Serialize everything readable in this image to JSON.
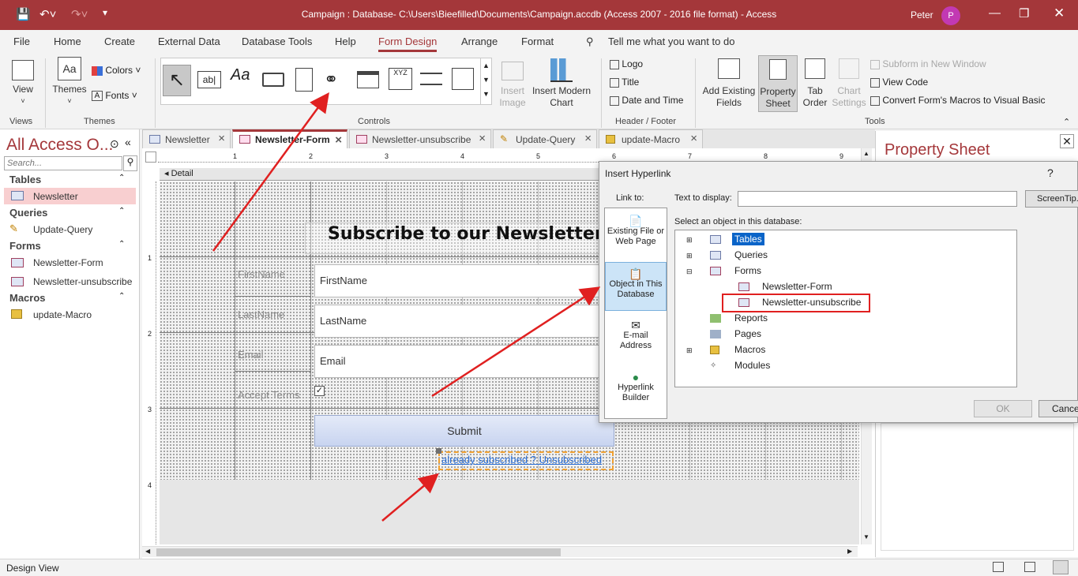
{
  "titlebar": {
    "title": "Campaign : Database- C:\\Users\\Bieefilled\\Documents\\Campaign.accdb (Access 2007 - 2016 file format)  -  Access",
    "user": "Peter",
    "avatar_letter": "P"
  },
  "menu": [
    "File",
    "Home",
    "Create",
    "External Data",
    "Database Tools",
    "Help",
    "Form Design",
    "Arrange",
    "Format"
  ],
  "tell_me": "Tell me what you want to do",
  "ribbon": {
    "view": "View",
    "themes": "Themes",
    "colors": "Colors",
    "fonts": "Fonts",
    "insert_image": "Insert Image",
    "insert_modern_chart": "Insert Modern Chart",
    "logo": "Logo",
    "title": "Title",
    "date_time": "Date and Time",
    "add_existing_fields": "Add Existing Fields",
    "property_sheet": "Property Sheet",
    "tab_order": "Tab Order",
    "chart_settings": "Chart Settings",
    "subform": "Subform in New Window",
    "view_code": "View Code",
    "convert_macros": "Convert Form's Macros to Visual Basic",
    "groups": {
      "views": "Views",
      "themes": "Themes",
      "controls": "Controls",
      "header_footer": "Header / Footer",
      "tools": "Tools"
    },
    "control_samples": {
      "textbox": "ab|",
      "label": "Aa",
      "xyz": "XYZ"
    }
  },
  "nav": {
    "header": "All Access O...",
    "search_placeholder": "Search...",
    "sections": [
      {
        "name": "Tables",
        "items": [
          "Newsletter"
        ]
      },
      {
        "name": "Queries",
        "items": [
          "Update-Query"
        ]
      },
      {
        "name": "Forms",
        "items": [
          "Newsletter-Form",
          "Newsletter-unsubscribe"
        ]
      },
      {
        "name": "Macros",
        "items": [
          "update-Macro"
        ]
      }
    ]
  },
  "tabs": [
    "Newsletter",
    "Newsletter-Form",
    "Newsletter-unsubscribe",
    "Update-Query",
    "update-Macro"
  ],
  "form": {
    "detail_label": "Detail",
    "heading": "Subscribe to our Newsletter!",
    "labels": [
      "FirstName",
      "LastName",
      "Email",
      "Accept Terms"
    ],
    "fields": [
      "FirstName",
      "LastName",
      "Email"
    ],
    "submit": "Submit",
    "link": "already subscribed ? Unsubscribed",
    "ruler_numbers": [
      "1",
      "2",
      "3",
      "4",
      "5",
      "6",
      "7",
      "8",
      "9"
    ],
    "vruler_numbers": [
      "1",
      "2",
      "3",
      "4"
    ]
  },
  "property_sheet": {
    "title": "Property Sheet"
  },
  "dialog": {
    "title": "Insert Hyperlink",
    "help": "?",
    "link_to": "Link to:",
    "text_to_display_label": "Text to display:",
    "text_to_display_value": "",
    "screentip": "ScreenTip...",
    "select_label": "Select an object in this database:",
    "link_options": [
      "Existing File or Web Page",
      "Object in This Database",
      "E-mail Address",
      "Hyperlink Builder"
    ],
    "tree": {
      "tables": "Tables",
      "queries": "Queries",
      "forms": "Forms",
      "form_items": [
        "Newsletter-Form",
        "Newsletter-unsubscribe"
      ],
      "reports": "Reports",
      "pages": "Pages",
      "macros": "Macros",
      "modules": "Modules"
    },
    "ok": "OK",
    "cancel": "Cancel"
  },
  "status": {
    "text": "Design View"
  }
}
